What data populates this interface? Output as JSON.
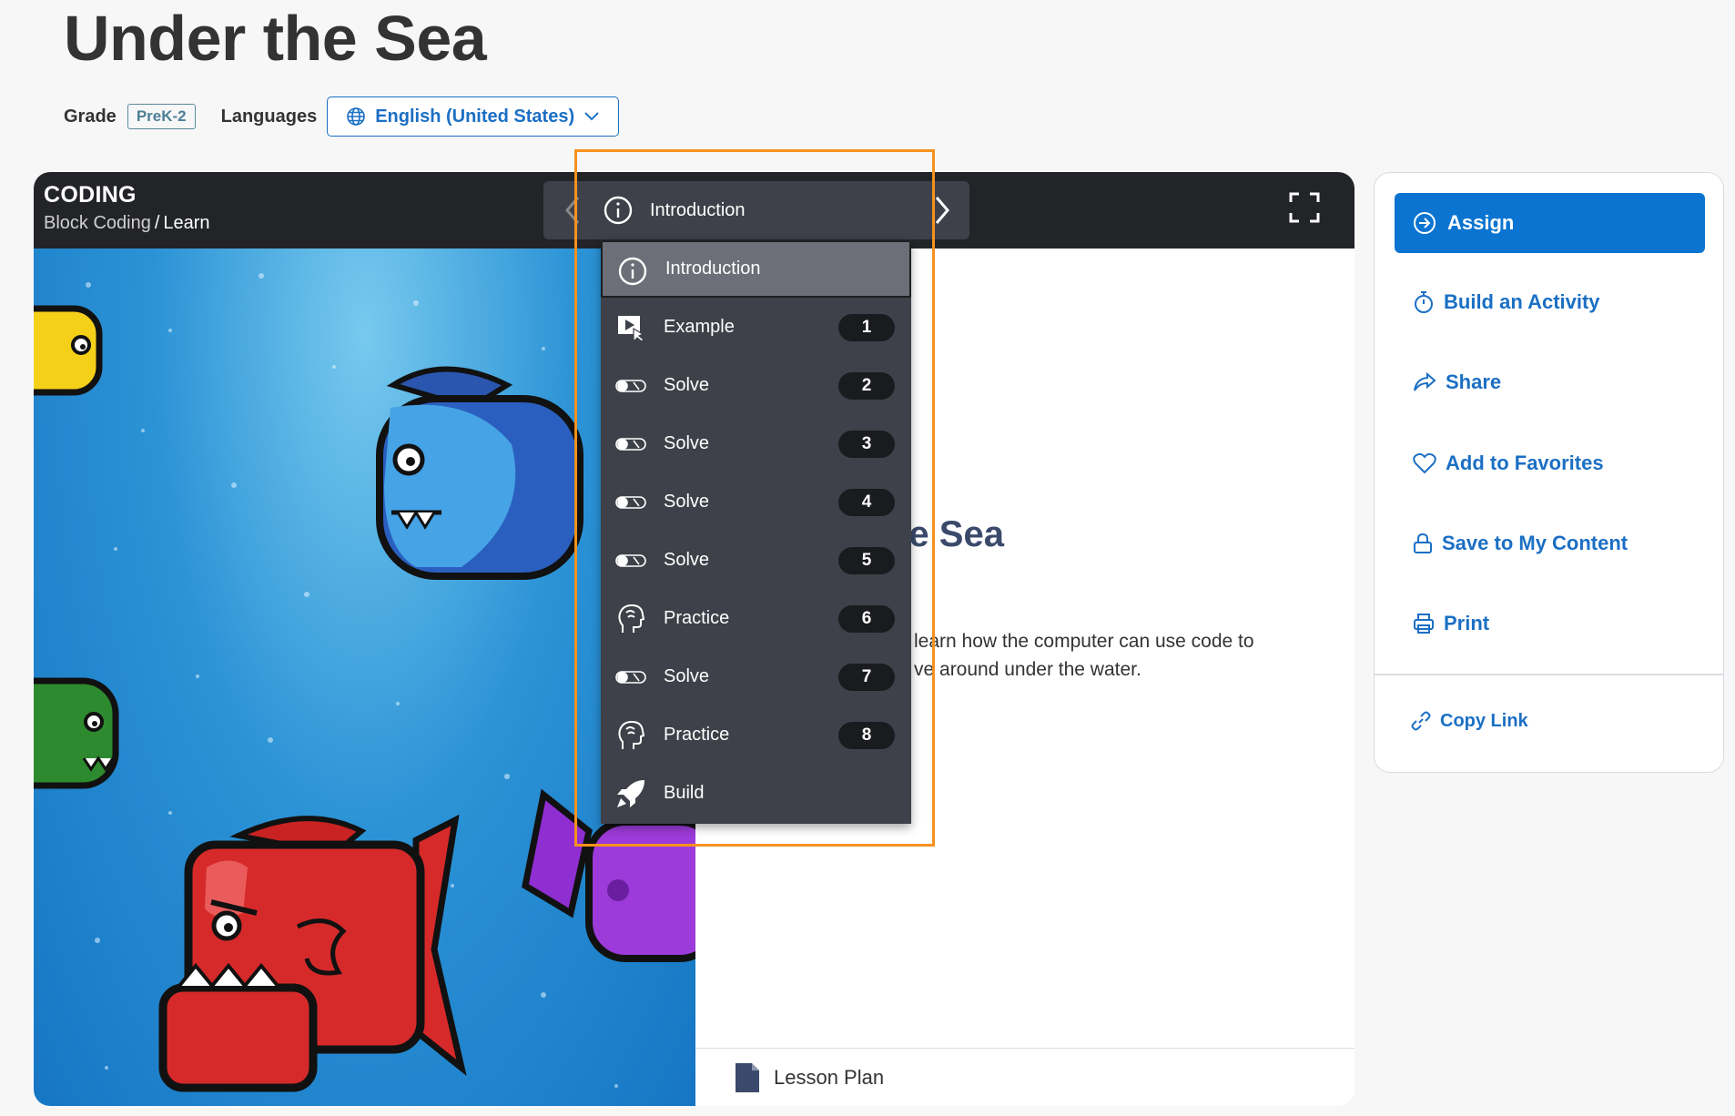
{
  "page": {
    "title": "Under the Sea",
    "grade_label": "Grade",
    "grade_value": "PreK-2",
    "languages_label": "Languages",
    "language_selected": "English (United States)"
  },
  "lesson": {
    "kicker": "CODING",
    "breadcrumb": {
      "parent": "Block Coding",
      "separator": "/",
      "current": "Learn"
    },
    "nav_current": "Introduction",
    "content_title_visible": "he Sea",
    "content_desc_line1": "learn how the computer can use code to",
    "content_desc_line2": "ve around under the water.",
    "lesson_plan_label": "Lesson Plan"
  },
  "menu": {
    "items": [
      {
        "label": "Introduction",
        "icon": "info-icon",
        "number": "",
        "active": true
      },
      {
        "label": "Example",
        "icon": "play-cursor-icon",
        "number": "1"
      },
      {
        "label": "Solve",
        "icon": "toggle-icon",
        "number": "2"
      },
      {
        "label": "Solve",
        "icon": "toggle-icon",
        "number": "3"
      },
      {
        "label": "Solve",
        "icon": "toggle-icon",
        "number": "4"
      },
      {
        "label": "Solve",
        "icon": "toggle-icon",
        "number": "5"
      },
      {
        "label": "Practice",
        "icon": "head-icon",
        "number": "6"
      },
      {
        "label": "Solve",
        "icon": "toggle-icon",
        "number": "7"
      },
      {
        "label": "Practice",
        "icon": "head-icon",
        "number": "8"
      },
      {
        "label": "Build",
        "icon": "rocket-icon",
        "number": ""
      }
    ]
  },
  "sidebar": {
    "assign": "Assign",
    "build_activity": "Build an Activity",
    "share": "Share",
    "favorites": "Add to Favorites",
    "save": "Save to My Content",
    "print": "Print",
    "copy_link": "Copy Link"
  },
  "colors": {
    "accent": "#0b74d1",
    "link": "#1b6fc4",
    "highlight": "#f5921e",
    "lesson_bar": "#222428",
    "menu_bg": "#3e4149"
  }
}
